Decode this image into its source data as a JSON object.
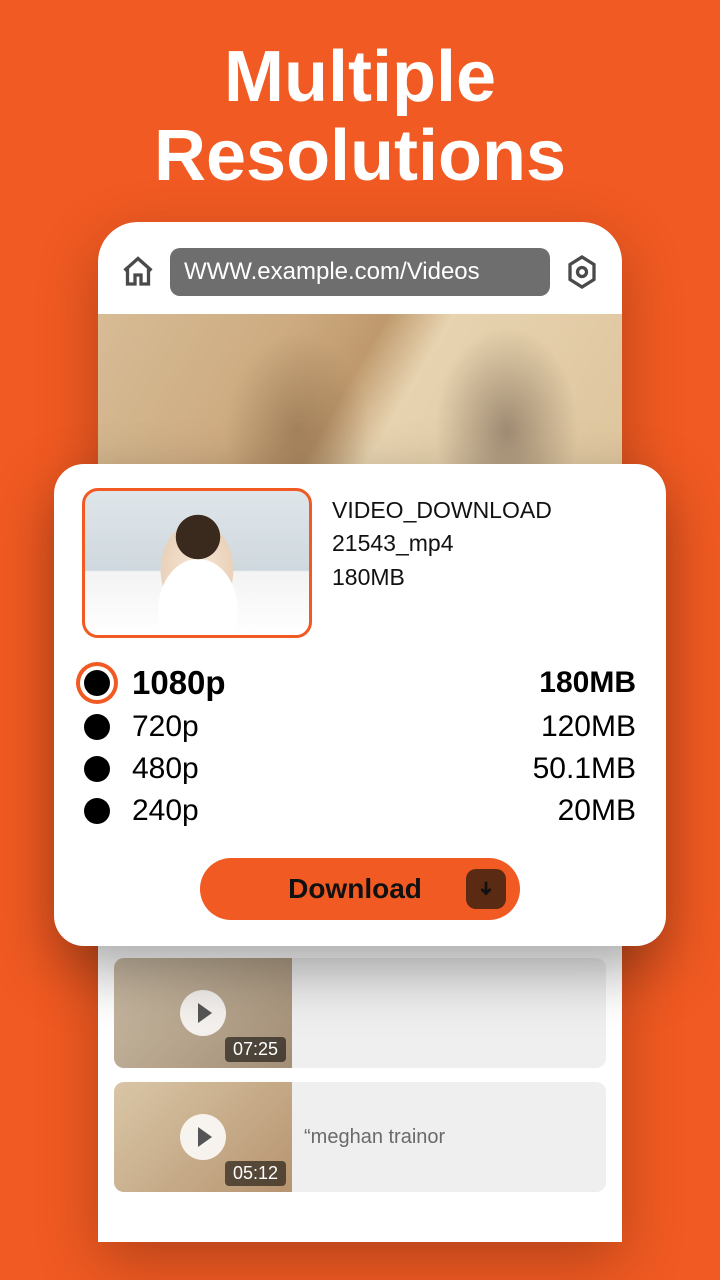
{
  "headline_line1": "Multiple",
  "headline_line2": "Resolutions",
  "urlbar_text": "WWW.example.com/Videos",
  "feed": [
    {
      "duration": "07:25",
      "title": ""
    },
    {
      "duration": "05:12",
      "title": "“meghan trainor"
    }
  ],
  "dialog": {
    "file_title": "VIDEO_DOWNLOAD",
    "file_name": "21543_mp4",
    "file_size": "180MB",
    "download_label": "Download",
    "resolutions": [
      {
        "label": "1080p",
        "size": "180MB",
        "selected": true
      },
      {
        "label": "720p",
        "size": "120MB",
        "selected": false
      },
      {
        "label": "480p",
        "size": "50.1MB",
        "selected": false
      },
      {
        "label": "240p",
        "size": "20MB",
        "selected": false
      }
    ]
  }
}
